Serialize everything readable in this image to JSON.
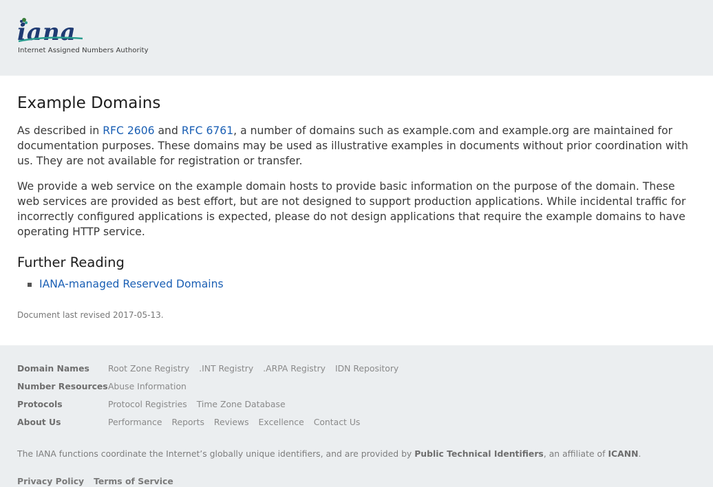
{
  "header": {
    "logo_word": "iana",
    "logo_tagline": "Internet Assigned Numbers Authority"
  },
  "main": {
    "title": "Example Domains",
    "para1": {
      "before": "As described in ",
      "rfc1": "RFC 2606",
      "mid": " and ",
      "rfc2": "RFC 6761",
      "after": ", a number of domains such as example.com and example.org are maintained for documentation purposes. These domains may be used as illustrative examples in documents without prior coordination with us. They are not available for registration or transfer."
    },
    "para2": "We provide a web service on the example domain hosts to provide basic information on the purpose of the domain. These web services are provided as best effort, but are not designed to support production applications. While incidental traffic for incorrectly configured applications is expected, please do not design applications that require the example domains to have operating HTTP service.",
    "further_heading": "Further Reading",
    "further_links": [
      "IANA-managed Reserved Domains"
    ],
    "revised": "Document last revised 2017-05-13."
  },
  "footer": {
    "rows": [
      {
        "label": "Domain Names",
        "links": [
          "Root Zone Registry",
          ".INT Registry",
          ".ARPA Registry",
          "IDN Repository"
        ]
      },
      {
        "label": "Number Resources",
        "links": [
          "Abuse Information"
        ]
      },
      {
        "label": "Protocols",
        "links": [
          "Protocol Registries",
          "Time Zone Database"
        ]
      },
      {
        "label": "About Us",
        "links": [
          "Performance",
          "Reports",
          "Reviews",
          "Excellence",
          "Contact Us"
        ]
      }
    ],
    "tagline_start": "The IANA functions coordinate the Internet’s globally unique identifiers, and are provided by ",
    "tagline_pti": "Public Technical Identifiers",
    "tagline_mid": ", an affiliate of ",
    "tagline_icann": "ICANN",
    "tagline_end": ".",
    "legal": [
      "Privacy Policy",
      "Terms of Service"
    ]
  },
  "colors": {
    "link": "#1a5fb4",
    "header_bg": "#ebeef0",
    "logo_teal": "#2a9d8f",
    "logo_navy": "#1f3b73"
  }
}
